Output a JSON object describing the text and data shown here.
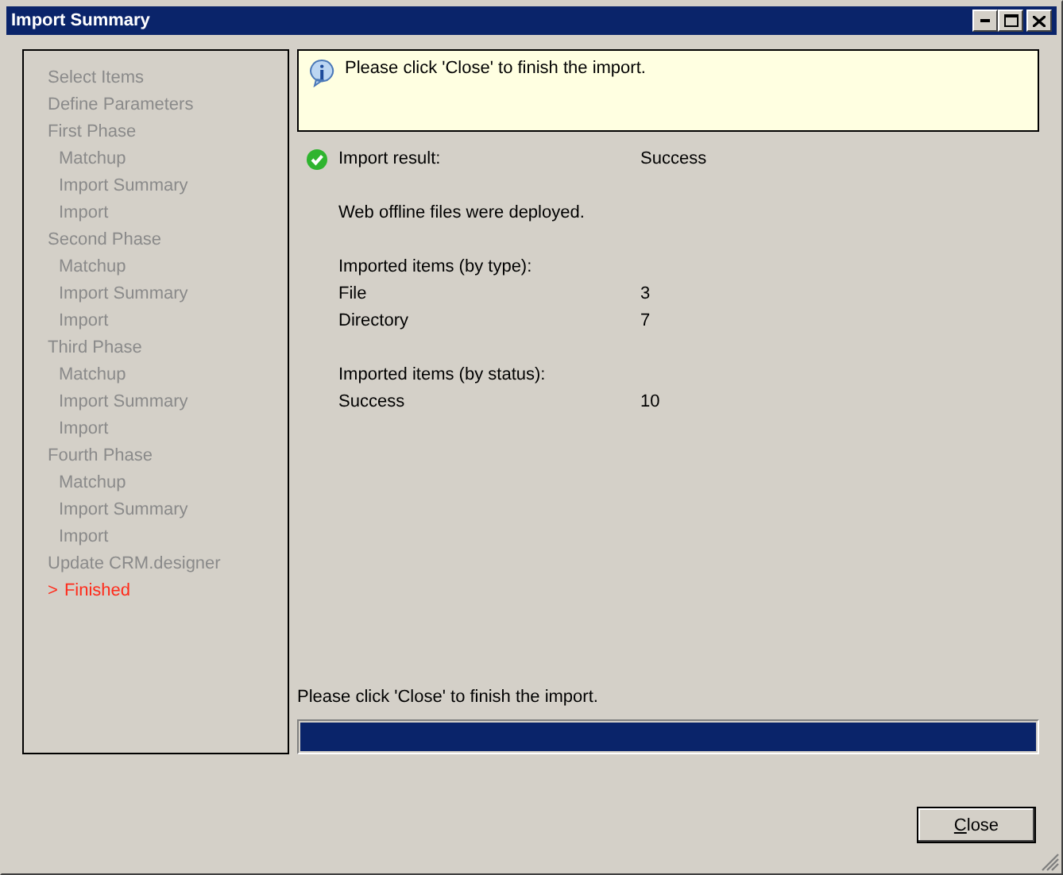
{
  "window": {
    "title": "Import Summary",
    "controls": [
      {
        "kind": "minimize"
      },
      {
        "kind": "maximize"
      },
      {
        "kind": "close"
      }
    ]
  },
  "steps": [
    {
      "label": "Select Items",
      "selected": false
    },
    {
      "label": "Define Parameters",
      "selected": false
    },
    {
      "label": "First Phase",
      "selected": false,
      "children": [
        {
          "label": "Matchup",
          "selected": false
        },
        {
          "label": "Import Summary",
          "selected": false
        },
        {
          "label": "Import",
          "selected": false
        }
      ]
    },
    {
      "label": "Second Phase",
      "selected": false,
      "children": [
        {
          "label": "Matchup",
          "selected": false
        },
        {
          "label": "Import Summary",
          "selected": false
        },
        {
          "label": "Import",
          "selected": false
        }
      ]
    },
    {
      "label": "Third Phase",
      "selected": false,
      "children": [
        {
          "label": "Matchup",
          "selected": false
        },
        {
          "label": "Import Summary",
          "selected": false
        },
        {
          "label": "Import",
          "selected": false
        }
      ]
    },
    {
      "label": "Fourth Phase",
      "selected": false,
      "children": [
        {
          "label": "Matchup",
          "selected": false
        },
        {
          "label": "Import Summary",
          "selected": false
        },
        {
          "label": "Import",
          "selected": false
        }
      ]
    },
    {
      "label": "Update CRM.designer",
      "selected": false
    },
    {
      "label": "Finished",
      "selected": true,
      "marker": ">"
    }
  ],
  "info": {
    "message": "Please click 'Close' to finish the import."
  },
  "result": {
    "label": "Import result:",
    "value": "Success",
    "kind": "success"
  },
  "note": "Web offline files were deployed.",
  "groups": [
    {
      "heading": "Imported items (by type):",
      "rows": [
        {
          "name": "File",
          "count": "3"
        },
        {
          "name": "Directory",
          "count": "7"
        }
      ]
    },
    {
      "heading": "Imported items (by status):",
      "rows": [
        {
          "name": "Success",
          "count": "10"
        }
      ]
    }
  ],
  "footer_message": "Please click 'Close' to finish the import.",
  "progress": {
    "level": 1
  },
  "buttons": [
    {
      "label": "Close",
      "underline_first": true
    }
  ]
}
